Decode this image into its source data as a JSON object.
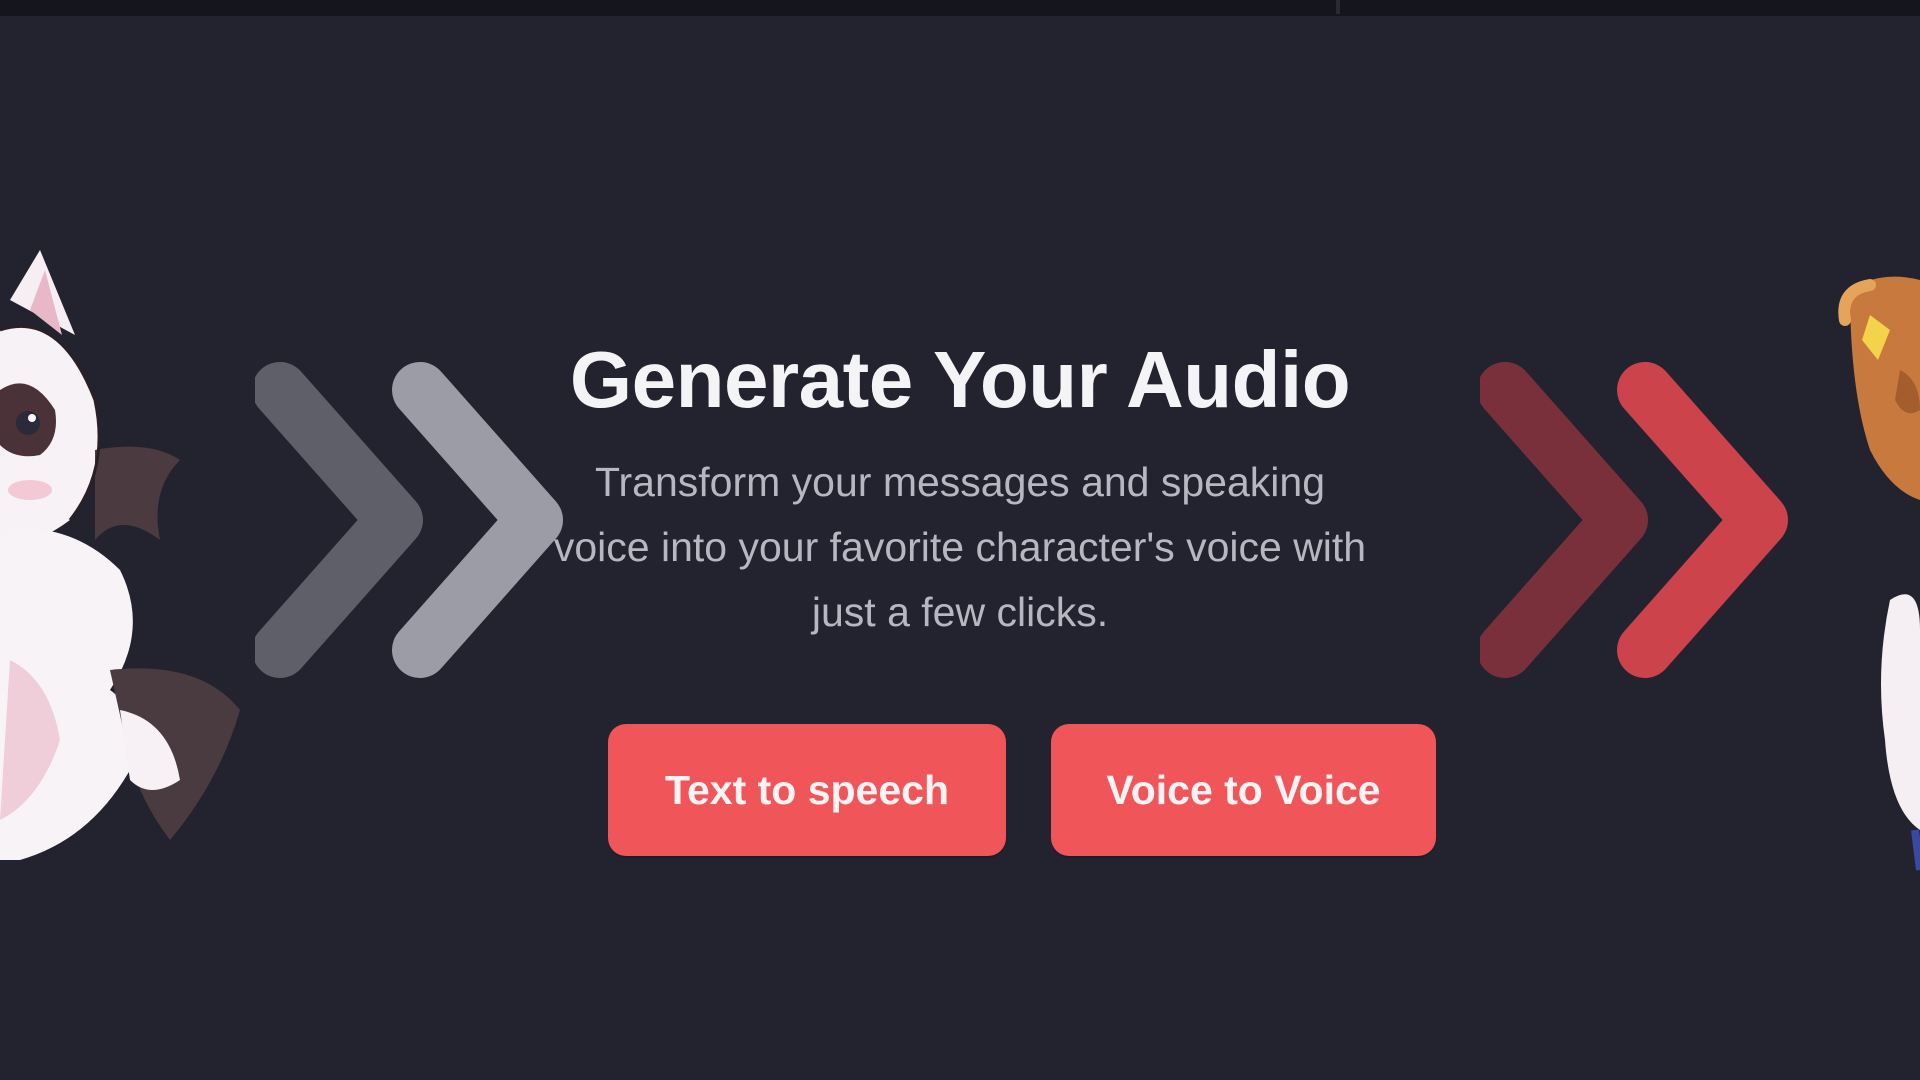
{
  "top_bar": {},
  "hero": {
    "title": "Generate Your Audio",
    "subtitle": "Transform your messages and speaking voice into your favorite character's voice with just a few clicks."
  },
  "actions": {
    "text_to_speech_label": "Text to speech",
    "voice_to_voice_label": "Voice to Voice"
  },
  "colors": {
    "background": "#23232f",
    "accent": "#f0555a",
    "chevron_left": "#8a8a94",
    "chevron_right": "#c8434a"
  },
  "icons": {
    "left_decoration": "double-chevron-right-icon",
    "right_decoration": "double-chevron-right-icon",
    "left_character": "white-fox-mascot",
    "right_character": "orange-character-mascot"
  }
}
